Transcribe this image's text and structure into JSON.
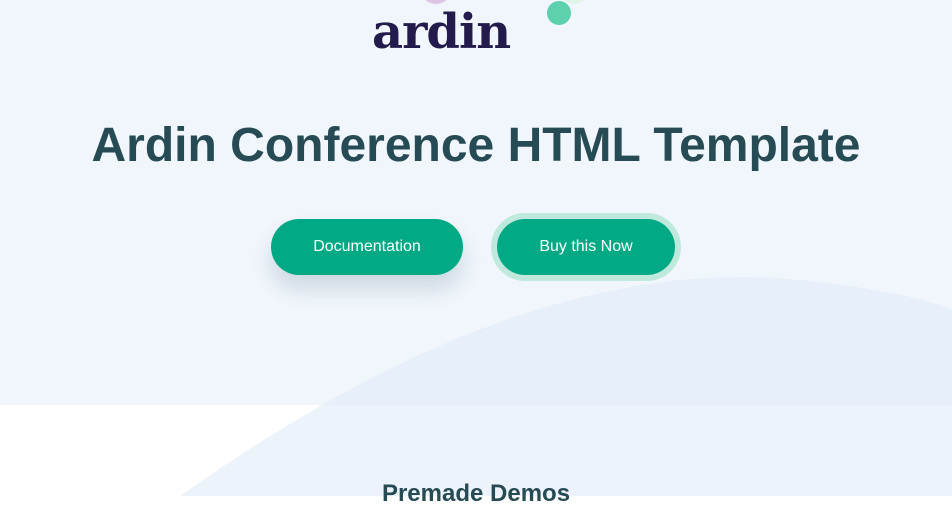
{
  "brand": {
    "logo_text": "ardin"
  },
  "hero": {
    "title": "Ardin Conference HTML Template",
    "buttons": {
      "documentation_label": "Documentation",
      "buy_label": "Buy this Now"
    }
  },
  "section": {
    "title": "Premade Demos"
  },
  "colors": {
    "accent": "#02a985",
    "heading": "#264b54",
    "hero_background": "#f1f6fc",
    "logo": "#231b4b"
  },
  "icons": [
    "logo-pink-dot-icon",
    "logo-green-dot-icon"
  ]
}
